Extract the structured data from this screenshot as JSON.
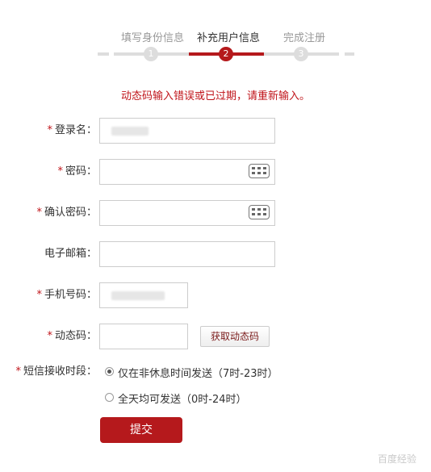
{
  "steps": [
    {
      "label": "填写身份信息",
      "number": "1"
    },
    {
      "label": "补充用户信息",
      "number": "2"
    },
    {
      "label": "完成注册",
      "number": "3"
    }
  ],
  "error": "动态码输入错误或已过期，请重新输入。",
  "form": {
    "required_mark": "*",
    "login_name_label": "登录名：",
    "password_label": "密码：",
    "confirm_password_label": "确认密码：",
    "email_label": "电子邮箱：",
    "phone_label": "手机号码：",
    "code_label": "动态码：",
    "get_code_button": "获取动态码",
    "sms_time_label": "短信接收时段：",
    "sms_option_1": "仅在非休息时间发送（7时-23时）",
    "sms_option_2": "全天均可发送（0时-24时）",
    "submit": "提交"
  },
  "watermark": "百度经验",
  "accent_color": "#b5191c"
}
